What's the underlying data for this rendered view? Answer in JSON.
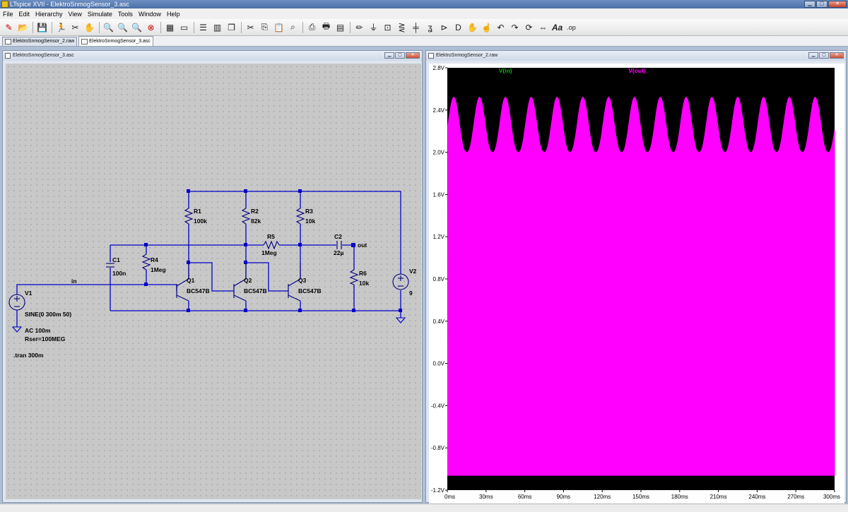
{
  "app": {
    "title": "LTspice XVII - ElektroSnmogSensor_3.asc"
  },
  "menu": [
    "File",
    "Edit",
    "Hierarchy",
    "View",
    "Simulate",
    "Tools",
    "Window",
    "Help"
  ],
  "toolbar_icons": [
    "new-schematic",
    "open",
    "save",
    "run",
    "halt",
    "pan",
    "zoom-in",
    "zoom-full",
    "zoom-out",
    "zoom-cancel",
    "autoscale",
    "window-select",
    "tile-horizontal",
    "tile-vertical",
    "cascade",
    "cut",
    "copy",
    "paste",
    "find",
    "print-setup",
    "print",
    "print-preview",
    "draw-wire",
    "ground",
    "label-net",
    "resistor",
    "capacitor",
    "inductor",
    "diode",
    "component",
    "move",
    "drag",
    "undo",
    "redo",
    "rotate",
    "mirror",
    "text",
    "spice-directive"
  ],
  "tabs": [
    {
      "label": "ElektroSnmogSensor_2.raw",
      "active": false
    },
    {
      "label": "ElektroSnmogSensor_3.asc",
      "active": true
    }
  ],
  "schematic": {
    "title": "ElektroSnmogSensor_3.asc",
    "labels": {
      "R1": "R1",
      "R1v": "100k",
      "R2": "R2",
      "R2v": "82k",
      "R3": "R3",
      "R3v": "10k",
      "R4": "R4",
      "R4v": "1Meg",
      "R5": "R5",
      "R5v": "1Meg",
      "R6": "R6",
      "R6v": "10k",
      "C1": "C1",
      "C1v": "100n",
      "C2": "C2",
      "C2v": "22µ",
      "Q1": "Q1",
      "Q1v": "BC547B",
      "Q2": "Q2",
      "Q2v": "BC547B",
      "Q3": "Q3",
      "Q3v": "BC547B",
      "V1": "V1",
      "V1src": "SINE(0 300m 50)",
      "V1ac": "AC 100m",
      "V1rser": "Rser=100MEG",
      "V2": "V2",
      "V2v": "9",
      "in": "in",
      "out": "out",
      "tran": ".tran 300m"
    }
  },
  "waveform": {
    "title": "ElektroSnmogSensor_2.raw",
    "traces": [
      {
        "name": "V(in)",
        "color": "#00c000"
      },
      {
        "name": "V(out)",
        "color": "#ff00ff"
      }
    ],
    "y_ticks": [
      "2.8V",
      "2.4V",
      "2.0V",
      "1.6V",
      "1.2V",
      "0.8V",
      "0.4V",
      "0.0V",
      "-0.4V",
      "-0.8V",
      "-1.2V"
    ],
    "x_ticks": [
      "0ms",
      "30ms",
      "60ms",
      "90ms",
      "120ms",
      "150ms",
      "180ms",
      "210ms",
      "240ms",
      "270ms",
      "300ms"
    ]
  },
  "chart_data": {
    "type": "line",
    "title": "",
    "xlabel": "",
    "ylabel": "",
    "xlim": [
      0,
      300
    ],
    "ylim": [
      -1.2,
      2.8
    ],
    "x_unit": "ms",
    "y_unit": "V",
    "grid": false,
    "series": [
      {
        "name": "V(in)",
        "color": "#00c000",
        "values": []
      },
      {
        "name": "V(out)",
        "color": "#ff00ff",
        "envelope_upper_peaks_ms": [
          5,
          25,
          45,
          65,
          85,
          105,
          125,
          145,
          165,
          185,
          205,
          225,
          245,
          265,
          285
        ],
        "upper_peak_v": 2.52,
        "upper_trough_v": 2.0,
        "lower_v": -1.06,
        "period_ms": 20,
        "start_ms": 0
      }
    ]
  },
  "colors": {
    "wire": "#0000c8",
    "component": "#000080",
    "label": "#000000",
    "plot_bg": "#000000",
    "vout": "#ff00ff",
    "vin": "#00c000",
    "dot": "#0000c8"
  }
}
